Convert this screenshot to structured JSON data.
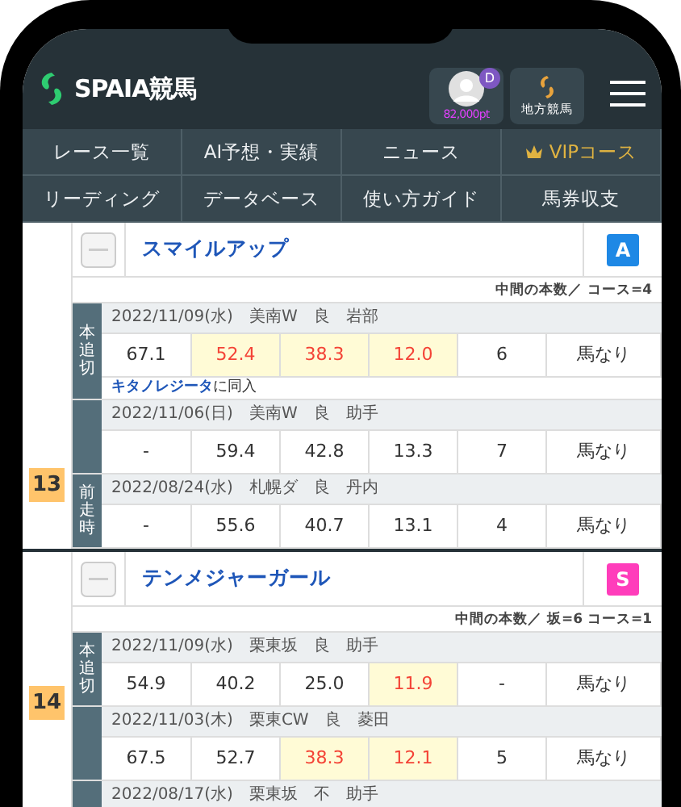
{
  "header": {
    "logo": "SPAIA競馬",
    "points": {
      "badge": "D",
      "value": "82,000pt"
    },
    "local_button": "地方競馬"
  },
  "nav": [
    {
      "label": "レース一覧",
      "kind": "plain"
    },
    {
      "label": "AI予想・実績",
      "kind": "plain"
    },
    {
      "label": "ニュース",
      "kind": "plain"
    },
    {
      "label": "VIPコース",
      "kind": "vip"
    },
    {
      "label": "リーディング",
      "kind": "plain"
    },
    {
      "label": "データベース",
      "kind": "plain"
    },
    {
      "label": "使い方ガイド",
      "kind": "plain"
    },
    {
      "label": "馬券収支",
      "kind": "plain"
    }
  ],
  "horses": [
    {
      "number": "13",
      "name": "スマイルアップ",
      "grade": "A",
      "color": "#1e88e5",
      "note": "中間の本数／ コース=4",
      "entries": [
        {
          "label": "本追切",
          "info": "2022/11/09(水)　美南W　良　岩部",
          "values": [
            {
              "text": "67.1",
              "highlight": false
            },
            {
              "text": "52.4",
              "highlight": true
            },
            {
              "text": "38.3",
              "highlight": true
            },
            {
              "text": "12.0",
              "highlight": true
            },
            {
              "text": "6",
              "highlight": false
            },
            {
              "text": "馬なり",
              "highlight": false
            }
          ],
          "remark": "**キタノレジータ**に同入"
        },
        {
          "info": "2022/11/06(日)　美南W　良　助手",
          "values": [
            {
              "text": "-",
              "highlight": false
            },
            {
              "text": "59.4",
              "highlight": false
            },
            {
              "text": "42.8",
              "highlight": false
            },
            {
              "text": "13.3",
              "highlight": false
            },
            {
              "text": "7",
              "highlight": false
            },
            {
              "text": "馬なり",
              "highlight": false
            }
          ]
        },
        {
          "label": "前走時",
          "info": "2022/08/24(水)　札幌ダ　良　丹内",
          "values": [
            {
              "text": "-",
              "highlight": false
            },
            {
              "text": "55.6",
              "highlight": false
            },
            {
              "text": "40.7",
              "highlight": false
            },
            {
              "text": "13.1",
              "highlight": false
            },
            {
              "text": "4",
              "highlight": false
            },
            {
              "text": "馬なり",
              "highlight": false
            }
          ]
        }
      ]
    },
    {
      "number": "14",
      "name": "テンメジャーガール",
      "grade": "S",
      "color": "#ff3dbb",
      "note": "中間の本数／ 坂=6  コース=1",
      "entries": [
        {
          "label": "本追切",
          "info": "2022/11/09(水)　栗東坂　良　助手",
          "values": [
            {
              "text": "54.9",
              "highlight": false
            },
            {
              "text": "40.2",
              "highlight": false
            },
            {
              "text": "25.0",
              "highlight": false
            },
            {
              "text": "11.9",
              "highlight": true
            },
            {
              "text": "-",
              "highlight": false
            },
            {
              "text": "馬なり",
              "highlight": false
            }
          ]
        },
        {
          "info": "2022/11/03(木)　栗東CW　良　菱田",
          "values": [
            {
              "text": "67.5",
              "highlight": false
            },
            {
              "text": "52.7",
              "highlight": false
            },
            {
              "text": "38.3",
              "highlight": true
            },
            {
              "text": "12.1",
              "highlight": true
            },
            {
              "text": "5",
              "highlight": false
            },
            {
              "text": "馬なり",
              "highlight": false
            }
          ]
        },
        {
          "info": "2022/08/17(水)　栗東坂　不　助手"
        }
      ]
    }
  ]
}
